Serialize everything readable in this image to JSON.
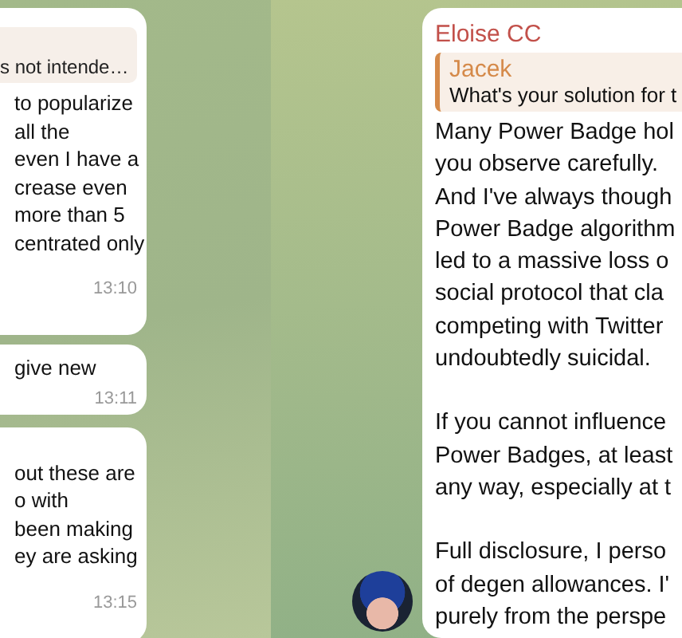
{
  "left_chat": {
    "messages": [
      {
        "quote": "s not intende…",
        "lines": [
          "to popularize",
          "all the",
          "even I have a",
          "crease even",
          "more than 5",
          "centrated only"
        ],
        "time": "13:10"
      },
      {
        "lines": [
          "give new"
        ],
        "time": "13:11"
      },
      {
        "lines": [
          "out these are",
          "o with",
          "been making",
          "ey are asking"
        ],
        "time": "13:15"
      }
    ]
  },
  "right_chat": {
    "message": {
      "sender": "Eloise CC",
      "reply": {
        "author": "Jacek",
        "text": "What's your solution for t"
      },
      "paragraphs": [
        [
          "Many Power Badge hol",
          "you observe carefully.",
          "And I've always though",
          "Power Badge algorithm",
          "led to a massive loss o",
          "social protocol that cla",
          "competing with Twitter",
          "undoubtedly suicidal."
        ],
        [
          "If you cannot influence",
          "Power Badges, at least",
          "any way, especially at t"
        ],
        [
          "Full disclosure, I perso",
          "of degen allowances. I'",
          "purely from the perspe"
        ]
      ]
    }
  }
}
